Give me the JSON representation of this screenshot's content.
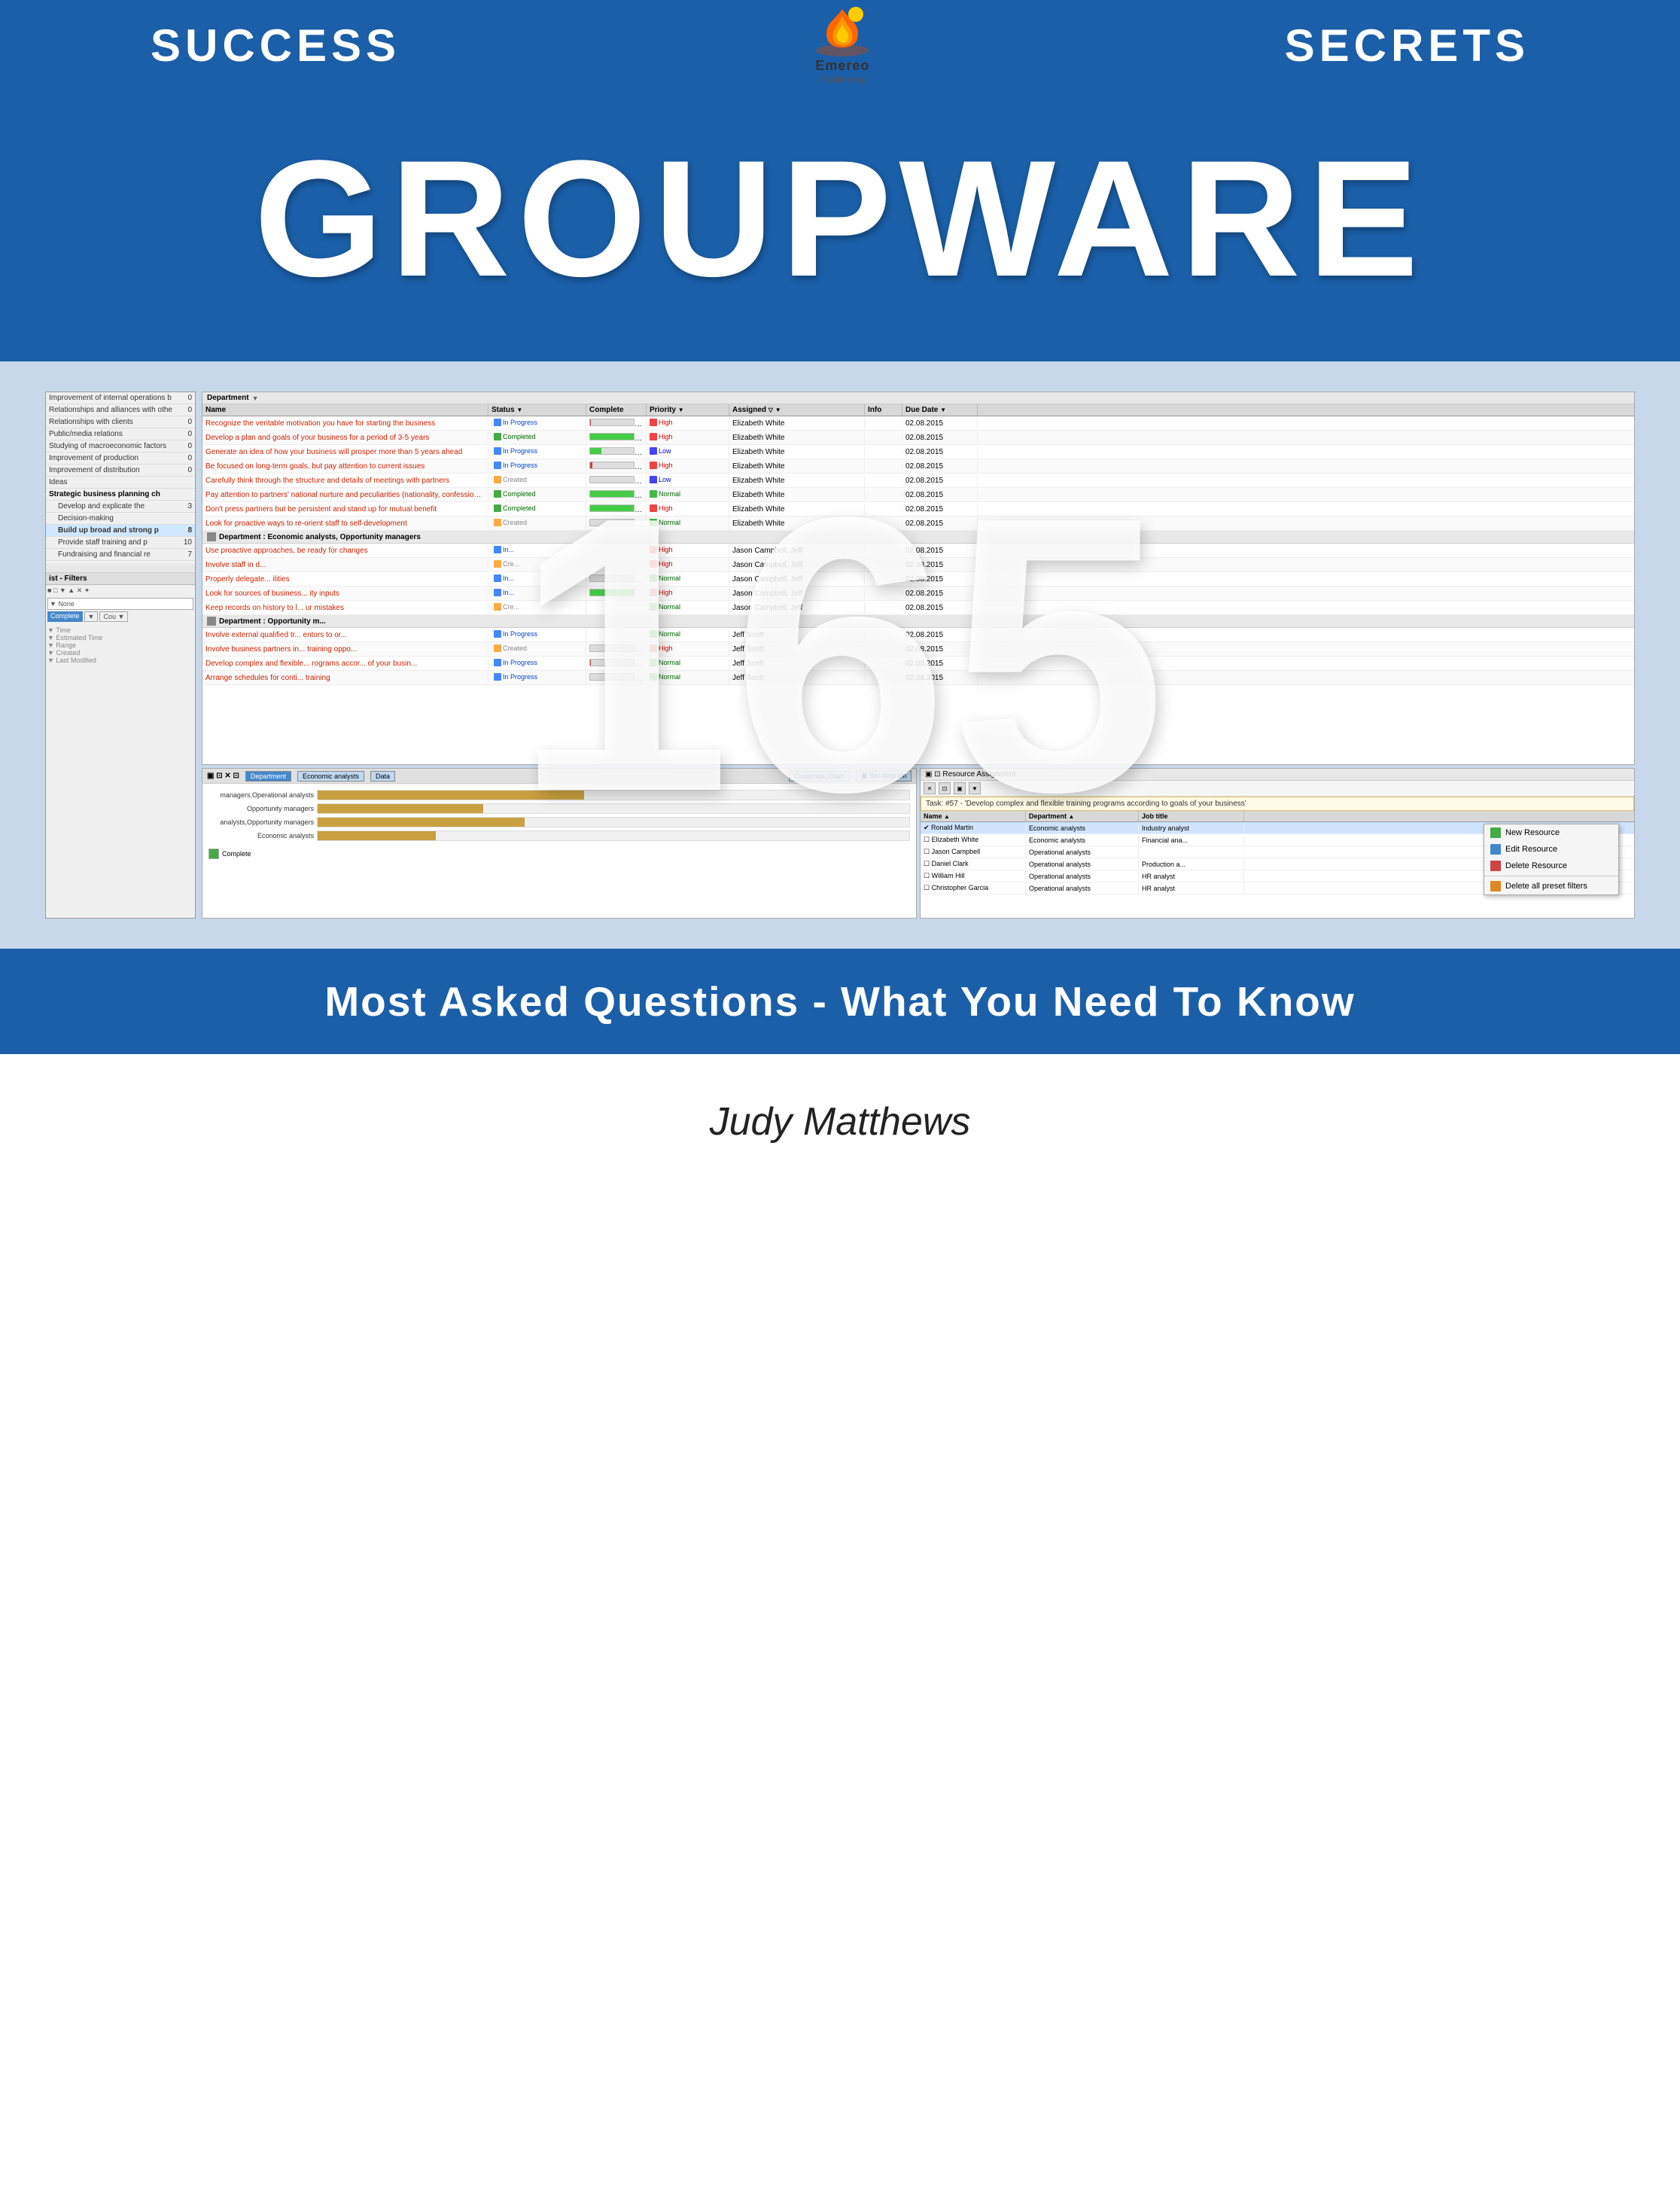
{
  "header": {
    "left_text": "SUCCESS",
    "right_text": "SECRETS",
    "publisher": "Emereo",
    "publisher_sub": "Publishing"
  },
  "hero": {
    "title": "GROUPWARE"
  },
  "big_number": "165",
  "left_panel": {
    "items": [
      {
        "label": "Improvement of internal operations b",
        "value": "0",
        "type": "normal"
      },
      {
        "label": "Relationships and alliances with othe",
        "value": "0",
        "type": "normal"
      },
      {
        "label": "Relationships with clients",
        "value": "0",
        "type": "normal"
      },
      {
        "label": "Public/media relations",
        "value": "0",
        "type": "normal"
      },
      {
        "label": "Studying of macroeconomic factors",
        "value": "0",
        "type": "normal"
      },
      {
        "label": "Improvement of production",
        "value": "0",
        "type": "normal"
      },
      {
        "label": "Improvement of distribution",
        "value": "0",
        "type": "normal"
      },
      {
        "label": "Ideas",
        "value": "",
        "type": "normal"
      },
      {
        "label": "Strategic business planning ch",
        "value": "",
        "type": "bold"
      },
      {
        "label": "Develop and explicate the",
        "value": "3",
        "type": "indented"
      },
      {
        "label": "Decision-making",
        "value": "",
        "type": "indented"
      },
      {
        "label": "Build up broad and strong p",
        "value": "8",
        "type": "indented highlighted"
      },
      {
        "label": "Provide staff training and p",
        "value": "10",
        "type": "indented"
      },
      {
        "label": "Fundraising and financial re",
        "value": "7",
        "type": "indented"
      }
    ]
  },
  "departments": [
    {
      "name": "Department",
      "tasks": [
        {
          "name": "Recognize the veritable motivation you have for starting the business",
          "status": "In Progress",
          "complete": 1,
          "priority": "High",
          "assigned": "Elizabeth White",
          "due": "02.08.2015"
        },
        {
          "name": "Develop a plan and goals of your business for a period of 3-5 years",
          "status": "Completed",
          "complete": 100,
          "priority": "High",
          "assigned": "Elizabeth White",
          "due": "02.08.2015"
        },
        {
          "name": "Generate an idea of how your business will prosper more than 5 years ahead",
          "status": "In Progress",
          "complete": 25,
          "priority": "Low",
          "assigned": "Elizabeth White",
          "due": "02.08.2015"
        },
        {
          "name": "Be focused on long-term goals, but pay attention to current issues",
          "status": "In Progress",
          "complete": 5,
          "priority": "High",
          "assigned": "Elizabeth White",
          "due": "02.08.2015"
        },
        {
          "name": "Carefully think through the structure and details of meetings with partners",
          "status": "Created",
          "complete": 0,
          "priority": "Low",
          "assigned": "Elizabeth White",
          "due": "02.08.2015"
        },
        {
          "name": "Pay attention to partners' national nurture and peculiarities (nationality, confession, etc.)",
          "status": "Completed",
          "complete": 100,
          "priority": "Normal",
          "assigned": "Elizabeth White",
          "due": "02.08.2015"
        },
        {
          "name": "Don't press partners but be persistent and stand up for mutual benefit",
          "status": "Completed",
          "complete": 100,
          "priority": "High",
          "assigned": "Elizabeth White",
          "due": "02.08.2015"
        },
        {
          "name": "Look for proactive ways to re-orient staff to self-development",
          "status": "Created",
          "complete": 0,
          "priority": "Normal",
          "assigned": "Elizabeth White",
          "due": "02.08.2015"
        }
      ]
    },
    {
      "name": "Department : Economic analysts, Opportunity managers",
      "tasks": [
        {
          "name": "Use proactive approaches, be ready for changes",
          "status": "In Progress",
          "complete": 0,
          "priority": "High",
          "assigned": "Jason Campbell, Jeff",
          "due": "02.08.2015"
        },
        {
          "name": "Involve staff in d...",
          "status": "Created",
          "complete": 0,
          "priority": "High",
          "assigned": "Jason Campbell, Jeff",
          "due": "02.08.2015"
        },
        {
          "name": "Properly delegate... ilities",
          "status": "In Progress",
          "complete": 0,
          "priority": "Normal",
          "assigned": "Jason Campbell, Jeff",
          "due": "02.08.2015"
        },
        {
          "name": "Look for sources of business... ity inputs",
          "status": "In Progress",
          "complete": 100,
          "priority": "High",
          "assigned": "Jason Campbell, Jeff",
          "due": "02.08.2015"
        },
        {
          "name": "Keep records on history to l... ur mistakes",
          "status": "Created",
          "complete": 0,
          "priority": "Normal",
          "assigned": "Jason Campbell, Jeff",
          "due": "02.08.2015"
        }
      ]
    },
    {
      "name": "Department : Opportunity m...",
      "tasks": [
        {
          "name": "Involve external qualified tr... entors to or...",
          "status": "In Progress",
          "complete": 0,
          "priority": "Normal",
          "assigned": "Jeff Scott",
          "due": "02.08.2015"
        },
        {
          "name": "Involve business partners in... training oppo...",
          "status": "Created",
          "complete": 0,
          "priority": "High",
          "assigned": "Jeff Scott",
          "due": "02.08.2015"
        },
        {
          "name": "Develop complex and flexible... rograms accor... of your busin...",
          "status": "In Progress",
          "complete": 1,
          "priority": "Normal",
          "assigned": "Jeff Scott",
          "due": "02.08.2015"
        },
        {
          "name": "Arrange schedules for conti... training",
          "status": "In Progress",
          "complete": 0,
          "priority": "Normal",
          "assigned": "Jeff Scott",
          "due": "02.08.2015"
        }
      ]
    }
  ],
  "chart": {
    "title": "ist - Filters",
    "tabs": [
      "Department",
      "Economic analysts",
      "Data"
    ],
    "buttons": [
      "Customize Chart",
      "Bar diagram"
    ],
    "rows": [
      {
        "label": "managers, Operational analysts",
        "pct": 45
      },
      {
        "label": "Opportunity managers",
        "pct": 30
      },
      {
        "label": "analysts, Opportunity managers",
        "pct": 35
      },
      {
        "label": "Economic analysts",
        "pct": 20
      }
    ],
    "legend_complete": "Complete"
  },
  "resource_table": {
    "task_note": "Task: #57 - 'Develop complex and flexible training programs according to goals of your business'",
    "columns": [
      "Name",
      "Department",
      "Job title"
    ],
    "rows": [
      {
        "name": "Ronald Martin",
        "dept": "Economic analysts",
        "job": "Industry analyst",
        "checked": true
      },
      {
        "name": "Elizabeth White",
        "dept": "Economic analysts",
        "job": "Financial ana...",
        "checked": false
      },
      {
        "name": "Jason Campbell",
        "dept": "Operational analysts",
        "job": "...",
        "checked": false
      },
      {
        "name": "Daniel Clark",
        "dept": "Operational analysts",
        "job": "Production a...",
        "checked": false
      },
      {
        "name": "William Hill",
        "dept": "Operational analysts",
        "job": "HR analyst",
        "checked": false
      },
      {
        "name": "Christopher Garcia",
        "dept": "Operational analysts",
        "job": "HR analyst",
        "checked": false
      }
    ]
  },
  "context_menu": {
    "items": [
      {
        "label": "New Resource",
        "color": "green"
      },
      {
        "label": "Edit Resource",
        "color": "blue"
      },
      {
        "label": "Delete Resource",
        "color": "red"
      },
      {
        "label": "Delete all preset filters",
        "color": "orange"
      }
    ]
  },
  "bottom_band": {
    "text": "Most Asked Questions - What You Need To Know"
  },
  "author": {
    "name": "Judy Matthews"
  }
}
